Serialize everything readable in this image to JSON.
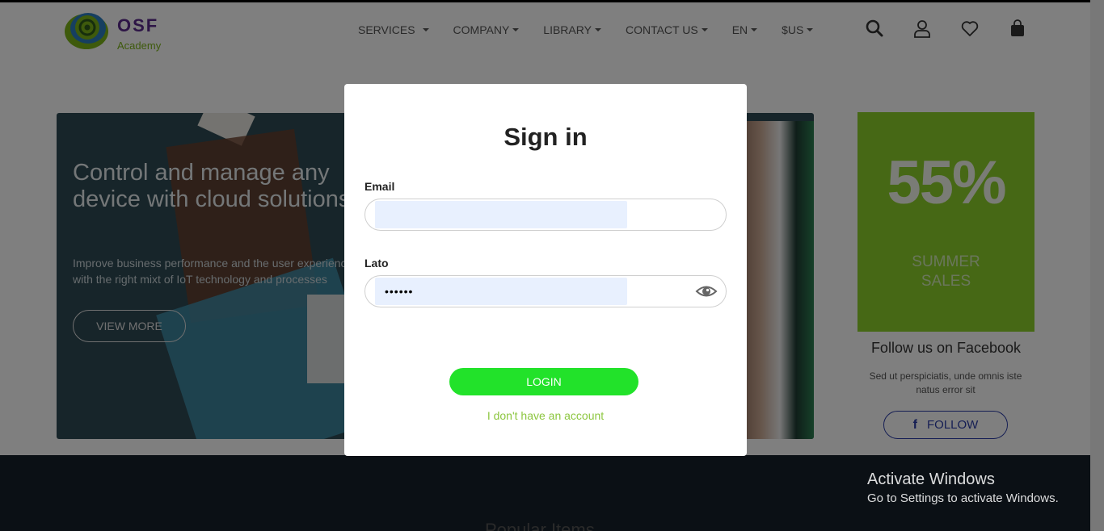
{
  "logo": {
    "title": "OSF",
    "subtitle": "Academy"
  },
  "nav": {
    "items": [
      "SERVICES",
      "COMPANY",
      "LIBRARY",
      "CONTACT US",
      "EN",
      "$US"
    ],
    "icons": [
      "search-icon",
      "user-icon",
      "heart-icon",
      "bag-icon"
    ]
  },
  "banner": {
    "title": "Control and manage any device with cloud solutions",
    "title_line1": "Control and manage any",
    "title_line2": "device with cloud solutions",
    "text_line1": "Improve business performance and the user experience",
    "text_line2": "with the right mixt of IoT technology and processes",
    "button": "VIEW MORE"
  },
  "promo": {
    "percent": "55%",
    "line1": "SUMMER",
    "line2": "SALES"
  },
  "facebook": {
    "title": "Follow us on Facebook",
    "text": "Sed ut perspiciatis, unde omnis iste natus error sit",
    "button": "FOLLOW"
  },
  "section": {
    "popular": "Popular Items"
  },
  "modal": {
    "title": "Sign in",
    "email_label": "Email",
    "email_value": "",
    "password_label": "Lato",
    "password_value": "••••••",
    "login_button": "LOGIN",
    "no_account_link": "I don't have an account"
  },
  "watermark": {
    "title": "Activate Windows",
    "subtitle": "Go to Settings to activate Windows."
  },
  "colors": {
    "accent_green": "#22e22a",
    "brand_purple": "#5b2a8c",
    "link_green": "#8cc63f",
    "promo_green": "#8cd02a",
    "facebook_blue": "#2b3da8"
  }
}
